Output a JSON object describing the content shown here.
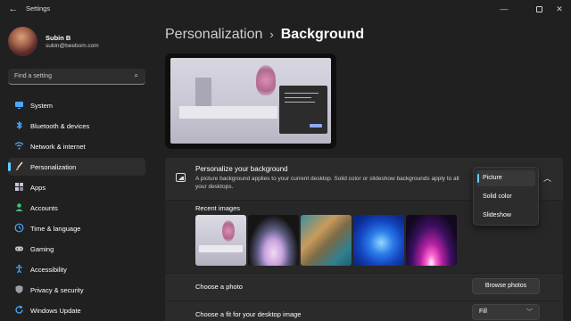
{
  "window": {
    "title": "Settings",
    "back_icon": "arrow-left-icon"
  },
  "profile": {
    "name": "Subin B",
    "email": "subin@beebom.com"
  },
  "search": {
    "placeholder": "Find a setting"
  },
  "sidebar": {
    "accent": "#60cdff",
    "items": [
      {
        "label": "System",
        "icon": "monitor-icon",
        "color": "#4aa8ff"
      },
      {
        "label": "Bluetooth & devices",
        "icon": "bluetooth-icon",
        "color": "#4aa8ff"
      },
      {
        "label": "Network & internet",
        "icon": "wifi-icon",
        "color": "#4aa8ff"
      },
      {
        "label": "Personalization",
        "icon": "brush-icon",
        "color": "#f0a060",
        "selected": true
      },
      {
        "label": "Apps",
        "icon": "apps-icon",
        "color": "#c8c8d8"
      },
      {
        "label": "Accounts",
        "icon": "person-icon",
        "color": "#3fc07a"
      },
      {
        "label": "Time & language",
        "icon": "globe-clock-icon",
        "color": "#4aa8ff"
      },
      {
        "label": "Gaming",
        "icon": "gamepad-icon",
        "color": "#c8c8c8"
      },
      {
        "label": "Accessibility",
        "icon": "accessibility-icon",
        "color": "#4aa8ff"
      },
      {
        "label": "Privacy & security",
        "icon": "shield-icon",
        "color": "#9aa0a8"
      },
      {
        "label": "Windows Update",
        "icon": "update-icon",
        "color": "#4aa8ff"
      }
    ]
  },
  "breadcrumb": {
    "parent": "Personalization",
    "separator": "›",
    "current": "Background"
  },
  "background": {
    "title": "Personalize your background",
    "description": "A picture background applies to your current desktop. Solid color or slideshow backgrounds apply to all your desktops.",
    "recent_title": "Recent images",
    "choose_photo_label": "Choose a photo",
    "browse_label": "Browse photos",
    "fit_label": "Choose a fit for your desktop image",
    "fit_value": "Fill"
  },
  "dropdown": {
    "options": [
      "Picture",
      "Solid color",
      "Slideshow"
    ],
    "selected": "Picture"
  }
}
